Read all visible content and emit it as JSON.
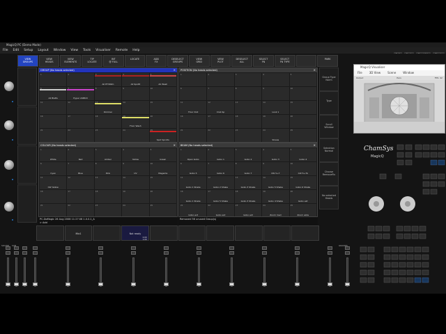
{
  "title": "MagicQ PC (Demo Mode)",
  "menu": [
    "File",
    "Edit",
    "Setup",
    "Layout",
    "Window",
    "View",
    "Tools",
    "Visualiser",
    "Remote",
    "Help"
  ],
  "top_right_buttons": [
    "Full",
    "Sook",
    "Frontdkk",
    "Single"
  ],
  "toolbar": [
    {
      "label": "VIEW\nGROUPS",
      "active": true
    },
    {
      "label": "VIEW\nHEADS",
      "active": false
    },
    {
      "label": "VIEW\nELEMENTS",
      "active": false
    },
    {
      "label": "TIP\nLOCATE",
      "active": false
    },
    {
      "label": "INT\n@ FULL",
      "active": false
    },
    {
      "label": "LOCATE",
      "active": false
    },
    {
      "label": "ADD\nFX",
      "active": false
    },
    {
      "label": "DESELECT\nGROUPS",
      "active": false
    },
    {
      "label": "VIEW\nGRID",
      "active": false
    },
    {
      "label": "VIEW\nPLOT",
      "active": false
    },
    {
      "label": "DESELECT\nALL",
      "active": false
    },
    {
      "label": "SELECT\nFN",
      "active": false
    },
    {
      "label": "SELECT\nFN TYPE",
      "active": false
    },
    {
      "label": "",
      "active": false
    },
    {
      "label": "PARK",
      "active": false
    }
  ],
  "group_window": {
    "title": "GROUP (No heads selected)",
    "cells": [
      {
        "num": "1",
        "label": "",
        "color": ""
      },
      {
        "num": "2",
        "label": "",
        "color": ""
      },
      {
        "num": "3",
        "label": "All PT300m",
        "color": "#aa2222"
      },
      {
        "num": "4",
        "label": "All Spotlt",
        "color": "#aa2222"
      },
      {
        "num": "5",
        "label": "All Wash",
        "color": "#cc4444"
      },
      {
        "num": "6",
        "label": "All Blatts",
        "color": "#cccccc"
      },
      {
        "num": "7",
        "label": "Hyper ASBtrill",
        "color": "#cc44cc"
      },
      {
        "num": "8",
        "label": "",
        "color": ""
      },
      {
        "num": "9",
        "label": "",
        "color": ""
      },
      {
        "num": "10",
        "label": "",
        "color": ""
      },
      {
        "num": "11",
        "label": "",
        "color": ""
      },
      {
        "num": "12",
        "label": "",
        "color": ""
      },
      {
        "num": "13",
        "label": "Dimmer",
        "color": "#dddd66"
      },
      {
        "num": "14",
        "label": "",
        "color": ""
      },
      {
        "num": "15",
        "label": "",
        "color": ""
      },
      {
        "num": "16",
        "label": "",
        "color": ""
      },
      {
        "num": "17",
        "label": "",
        "color": ""
      },
      {
        "num": "18",
        "label": "",
        "color": ""
      },
      {
        "num": "19",
        "label": "Floor Wash",
        "color": "#dddd66"
      },
      {
        "num": "20",
        "label": "",
        "color": ""
      },
      {
        "num": "21",
        "label": "",
        "color": ""
      },
      {
        "num": "22",
        "label": "",
        "color": ""
      },
      {
        "num": "23",
        "label": "",
        "color": ""
      },
      {
        "num": "24",
        "label": "",
        "color": ""
      },
      {
        "num": "25",
        "label": "Spot Sprolts",
        "color": "#cc2222"
      }
    ]
  },
  "position_window": {
    "title": "POSITION (No heads selected)",
    "cells": [
      "",
      "",
      "",
      "",
      "",
      "",
      "",
      "",
      "",
      "",
      "Floor Doll",
      "Club Sp",
      "",
      "Look 1",
      "",
      "",
      "",
      "",
      "",
      "",
      "",
      "",
      "",
      "Shows",
      ""
    ]
  },
  "colour_window": {
    "title": "COLOUR (No heads selected)",
    "cells": [
      "White",
      "Red",
      "Amber",
      "Yellow",
      "Green",
      "Cyan",
      "Blue",
      "Pink",
      "UV",
      "Magenta",
      "CW Yellow",
      "",
      "",
      "",
      "",
      "",
      "",
      "",
      "",
      "",
      "",
      "",
      "",
      "",
      ""
    ]
  },
  "beam_window": {
    "title": "BEAM (No heads selected)",
    "cells": [
      "Open Gobo",
      "Gobo 1",
      "Gobo 2",
      "Gobo 3",
      "Gobo 4",
      "Gobo 5",
      "Gobo 6",
      "Gobo 7",
      "CW 5+7",
      "CW 5+7b",
      "Gobo 1 Shake",
      "Gobo 2 Shake",
      "Gobo 3 Shake",
      "Gobo 5 Shake",
      "Gobo 6 Shake",
      "Gobo 1 Shake",
      "Gobo 5 Shake",
      "Gobo 3 Shake",
      "Gobo 4 Shake",
      "Gobo ext",
      "Gobo ext",
      "Gobo ext",
      "Gobo ext",
      "Zoom med",
      "Zoom wide"
    ]
  },
  "status": {
    "left": "PC-DoMagic 26 Aug 2008 11:27:08 1.0.0.1_A",
    "left2": "> Add",
    "right": "Removed 56 unused Group(s)"
  },
  "right_buttons": [
    "Group Type\nNorm",
    "Type",
    "Scroll\nWindow",
    "Selection\nNormal",
    "Choose\nRemoveFix",
    "No selected\nHeads"
  ],
  "visualiser": {
    "title": "MagicQ Visualiser",
    "menu": [
      "File",
      "3D View",
      "Scene",
      "Window"
    ],
    "left_status": "Output",
    "mid_status": "Pers",
    "right_status": "FPS: 42"
  },
  "brand": {
    "name": "ChamSys",
    "product": "MagicQ"
  },
  "playback_strip": [
    "",
    "Mix1",
    "",
    "Not ready",
    "",
    "",
    "",
    "",
    "",
    ""
  ],
  "playback_values": [
    "",
    "0.00",
    "1.00"
  ],
  "sound_label": "SOUND",
  "sub_label": "SUB",
  "grands_label": "GRANDS"
}
